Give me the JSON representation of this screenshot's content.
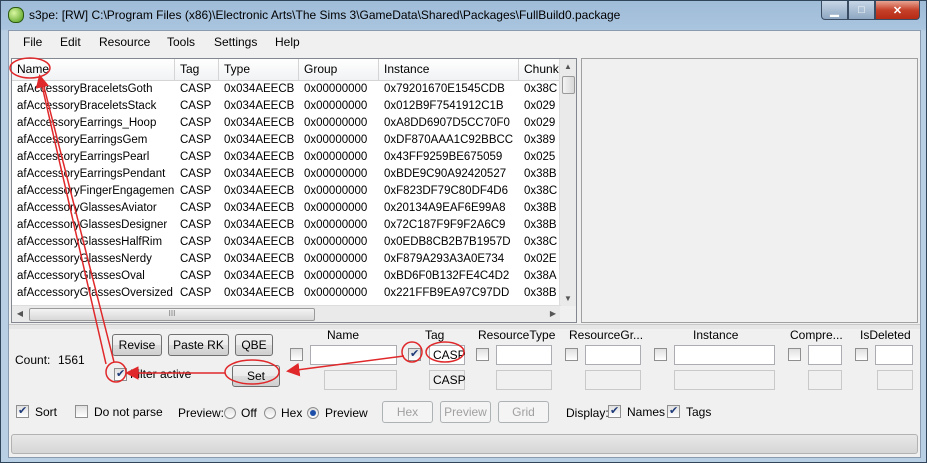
{
  "window": {
    "title": "s3pe: [RW] C:\\Program Files (x86)\\Electronic Arts\\The Sims 3\\GameData\\Shared\\Packages\\FullBuild0.package",
    "min_glyph": "▁",
    "max_glyph": "□",
    "close_glyph": "✕"
  },
  "menu": [
    "File",
    "Edit",
    "Resource",
    "Tools",
    "Settings",
    "Help"
  ],
  "grid": {
    "columns": [
      "Name",
      "Tag",
      "Type",
      "Group",
      "Instance",
      "Chunk"
    ],
    "rows": [
      [
        "afAccessoryBraceletsGoth",
        "CASP",
        "0x034AEECB",
        "0x00000000",
        "0x79201670E1545CDB",
        "0x38C"
      ],
      [
        "afAccessoryBraceletsStack",
        "CASP",
        "0x034AEECB",
        "0x00000000",
        "0x012B9F7541912C1B",
        "0x029"
      ],
      [
        "afAccessoryEarrings_Hoop",
        "CASP",
        "0x034AEECB",
        "0x00000000",
        "0xA8DD6907D5CC70F0",
        "0x029"
      ],
      [
        "afAccessoryEarringsGem",
        "CASP",
        "0x034AEECB",
        "0x00000000",
        "0xDF870AAA1C92BBCC",
        "0x389"
      ],
      [
        "afAccessoryEarringsPearl",
        "CASP",
        "0x034AEECB",
        "0x00000000",
        "0x43FF9259BE675059",
        "0x025"
      ],
      [
        "afAccessoryEarringsPendant",
        "CASP",
        "0x034AEECB",
        "0x00000000",
        "0xBDE9C90A92420527",
        "0x38B"
      ],
      [
        "afAccessoryFingerEngagemen...",
        "CASP",
        "0x034AEECB",
        "0x00000000",
        "0xF823DF79C80DF4D6",
        "0x38C"
      ],
      [
        "afAccessoryGlassesAviator",
        "CASP",
        "0x034AEECB",
        "0x00000000",
        "0x20134A9EAF6E99A8",
        "0x38B"
      ],
      [
        "afAccessoryGlassesDesigner",
        "CASP",
        "0x034AEECB",
        "0x00000000",
        "0x72C187F9F9F2A6C9",
        "0x38B"
      ],
      [
        "afAccessoryGlassesHalfRim",
        "CASP",
        "0x034AEECB",
        "0x00000000",
        "0x0EDB8CB2B7B1957D",
        "0x38C"
      ],
      [
        "afAccessoryGlassesNerdy",
        "CASP",
        "0x034AEECB",
        "0x00000000",
        "0xF879A293A3A0E734",
        "0x02E"
      ],
      [
        "afAccessoryGlassesOval",
        "CASP",
        "0x034AEECB",
        "0x00000000",
        "0xBD6F0B132FE4C4D2",
        "0x38A"
      ],
      [
        "afAccessoryGlassesOversized",
        "CASP",
        "0x034AEECB",
        "0x00000000",
        "0x221FFB9EA97C97DD",
        "0x38B"
      ]
    ],
    "scroll_up": "▲",
    "scroll_down": "▼",
    "scroll_left": "◀",
    "scroll_right": "▶",
    "hthumb_grip": "III"
  },
  "filter": {
    "count_label": "Count:",
    "count_value": "1561",
    "revise": "Revise",
    "paste_rk": "Paste RK",
    "qbe": "QBE",
    "filter_active": "Filter active",
    "filter_active_checked": true,
    "set": "Set",
    "fields": [
      {
        "label": "Name",
        "checked": false,
        "value": "",
        "current": ""
      },
      {
        "label": "Tag",
        "checked": true,
        "value": "CASP",
        "current": "CASP"
      },
      {
        "label": "ResourceType",
        "checked": false,
        "value": "",
        "current": ""
      },
      {
        "label": "ResourceGr...",
        "checked": false,
        "value": "",
        "current": ""
      },
      {
        "label": "Instance",
        "checked": false,
        "value": "",
        "current": ""
      },
      {
        "label": "Compre...",
        "checked": false,
        "value": "",
        "current": ""
      },
      {
        "label": "IsDeleted",
        "checked": false,
        "value": "",
        "current": ""
      }
    ]
  },
  "options": {
    "sort": "Sort",
    "sort_checked": true,
    "do_not_parse": "Do not parse",
    "do_not_parse_checked": false,
    "preview_label": "Preview:",
    "preview_off": "Off",
    "preview_hex": "Hex",
    "preview_preview": "Preview",
    "preview_selected": "Preview",
    "hex_btn": "Hex",
    "preview_btn": "Preview",
    "grid_btn": "Grid",
    "display_label": "Display:",
    "names": "Names",
    "names_checked": true,
    "tags": "Tags",
    "tags_checked": true
  },
  "colors": {
    "annotation_red": "#e0282a",
    "title_gradient": "#9fbcd8"
  }
}
